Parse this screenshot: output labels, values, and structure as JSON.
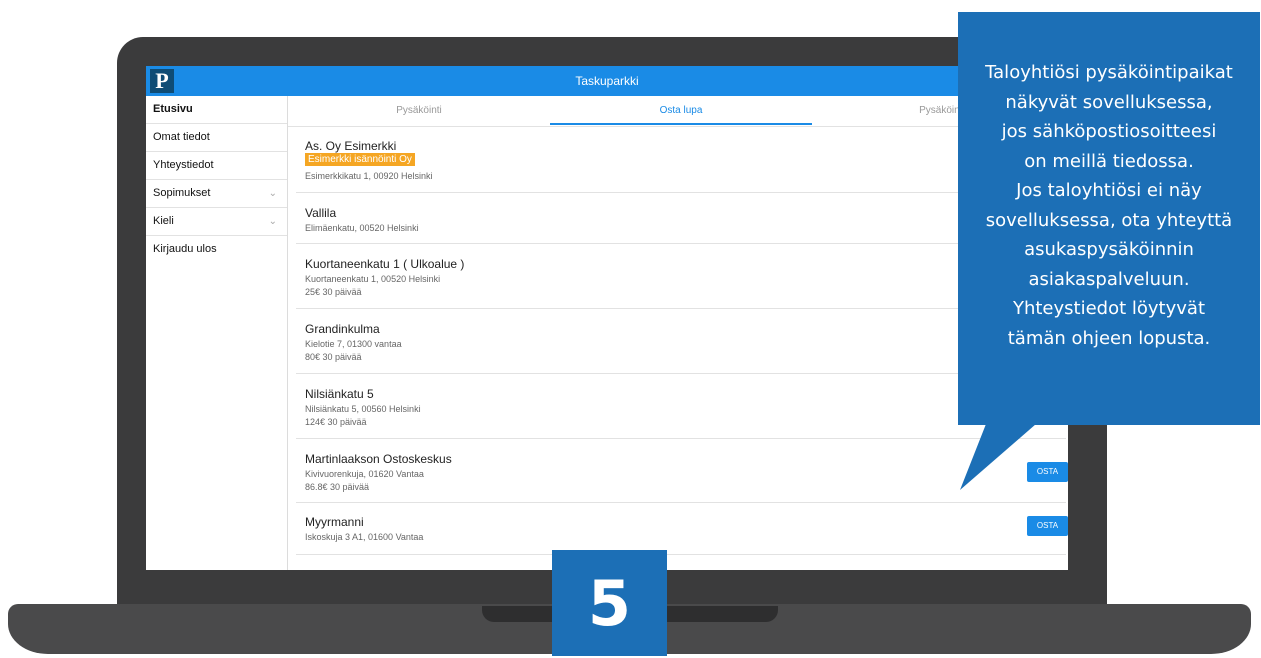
{
  "app": {
    "title": "Taskuparkki",
    "logo_letter": "P"
  },
  "sidebar": {
    "items": [
      {
        "label": "Etusivu"
      },
      {
        "label": "Omat tiedot"
      },
      {
        "label": "Yhteystiedot"
      },
      {
        "label": "Sopimukset",
        "chevron": "chevron-down-icon"
      },
      {
        "label": "Kieli",
        "chevron": "chevron-down-icon"
      },
      {
        "label": "Kirjaudu ulos"
      }
    ]
  },
  "tabs": [
    {
      "label": "Pysäköinti"
    },
    {
      "label": "Osta lupa",
      "active": true
    },
    {
      "label": "Pysäköintil"
    }
  ],
  "list": [
    {
      "title": "As. Oy Esimerkki",
      "badge": "Esimerkki isännöinti Oy",
      "address": "Esimerkkikatu 1, 00920 Helsinki"
    },
    {
      "title": "Vallila",
      "address": "Elimäenkatu, 00520 Helsinki"
    },
    {
      "title": "Kuortaneenkatu 1 ( Ulkoalue )",
      "address": "Kuortaneenkatu 1, 00520 Helsinki",
      "price": "25€ 30 päivää"
    },
    {
      "title": "Grandinkulma",
      "address": "Kielotie 7, 01300 vantaa",
      "price": "80€ 30 päivää"
    },
    {
      "title": "Nilsiänkatu 5",
      "address": "Nilsiänkatu 5, 00560 Helsinki",
      "price": "124€ 30 päivää"
    },
    {
      "title": "Martinlaakson Ostoskeskus",
      "address": "Kivivuorenkuja, 01620 Vantaa",
      "price": "86.8€ 30 päivää",
      "button": "OSTA"
    },
    {
      "title": "Myyrmanni",
      "address": "Iskoskuja 3 A1, 01600 Vantaa",
      "button": "OSTA"
    }
  ],
  "callout": {
    "lines": [
      "Taloyhtiösi pysäköintipaikat",
      "näkyvät sovelluksessa,",
      "jos sähköpostiosoitteesi",
      "on meillä tiedossa.",
      "Jos taloyhtiösi ei näy",
      "sovelluksessa, ota yhteyttä",
      "asukaspysäköinnin",
      "asiakaspalveluun.",
      "Yhteystiedot löytyvät",
      "tämän ohjeen lopusta."
    ]
  },
  "step_number": "5",
  "colors": {
    "accent": "#1a8be6",
    "callout": "#1c6fb6",
    "badge": "#f5a623"
  }
}
